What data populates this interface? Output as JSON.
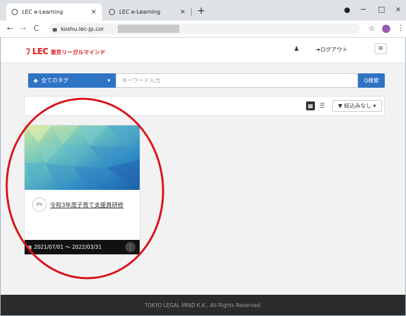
{
  "browser": {
    "tabs": [
      {
        "label": "LEC e-Learning",
        "close": "×"
      },
      {
        "label": "LEC e-Learning",
        "close": "×"
      }
    ],
    "new_tab": "+",
    "window_controls": {
      "minimize": "−",
      "maximize": "□",
      "close": "×"
    },
    "nav": {
      "back": "←",
      "forward": "→",
      "reload": "C"
    },
    "url": "koshu.lec-jp.cor",
    "star": "☆",
    "menu": "⋮"
  },
  "site": {
    "logo_mark": "ﾌ LEC",
    "logo_text": "東京リーガルマインド",
    "user_icon": "♟",
    "logout_label": "➜ログアウト",
    "hamburger": "≡"
  },
  "search": {
    "tag_label": "全てのタグ",
    "tag_caret": "▾",
    "keyword_placeholder": "キーワード入力",
    "search_button": "Q検索"
  },
  "filter": {
    "grid_icon": "▦",
    "list_icon": "☰",
    "filter_label": "▼ 絞込みなし ▾"
  },
  "course": {
    "progress": "3%",
    "title": "令和3年度子育て支援員研修",
    "date_range": "2021/07/01 〜 2022/03/31",
    "calendar_icon": "▦",
    "menu": "⋮"
  },
  "footer": {
    "copyright": "TOKYO LEGAL MIND K.K., All Rights Reserved."
  },
  "colors": {
    "accent": "#2f73c5",
    "brand_red": "#e21818",
    "annotation": "#d9141c"
  }
}
